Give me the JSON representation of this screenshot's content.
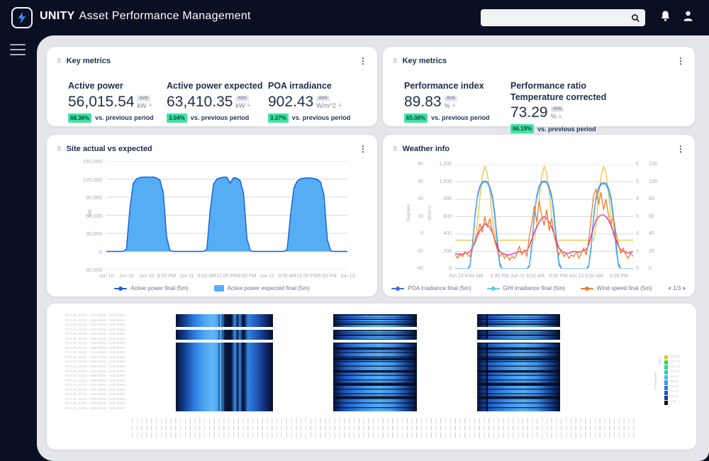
{
  "icons": {
    "kebab": "⋮",
    "drag": "⠿",
    "series_menu": "≡",
    "prev": "◀",
    "next": "▶"
  },
  "colors": {
    "header_bg": "#0b0f23",
    "content_bg": "#e5e6e9",
    "accent_blue": "#2f7ff0",
    "green_badge": "#3fe3a5",
    "site_fill": "#55aef4",
    "site_stroke": "#2a7de2",
    "site_actual": "#1a5fd9",
    "poa": "#3a6df0",
    "ghi": "#62c8f2",
    "wind": "#f07c2e",
    "yellow": "#f2c23e",
    "magenta": "#e8258e"
  },
  "header": {
    "brand_bold": "UNITY",
    "brand_rest": "Asset Performance Management",
    "search_placeholder": "",
    "search_value": ""
  },
  "cards": {
    "key_metrics_left": {
      "title": "Key metrics",
      "metrics": [
        {
          "label": "Active power",
          "value": "56,015.54",
          "avg_badge": "AVG",
          "unit": "kW",
          "change": "68.36%",
          "change_label": "vs. previous period"
        },
        {
          "label": "Active power expected",
          "value": "63,410.35",
          "avg_badge": "AVG",
          "unit": "kW",
          "change": "3.04%",
          "change_label": "vs. previous period"
        },
        {
          "label": "POA irradiance",
          "value": "902.43",
          "avg_badge": "AVG",
          "unit": "W/m^2",
          "change": "3.37%",
          "change_label": "vs. previous period"
        }
      ]
    },
    "key_metrics_right": {
      "title": "Key metrics",
      "metrics": [
        {
          "label": "Performance index",
          "value": "89.83",
          "avg_badge": "AVG",
          "unit": "%",
          "change": "65.08%",
          "change_label": "vs. previous period"
        },
        {
          "label": "Performance ratio\nTemperature corrected",
          "value": "73.29",
          "avg_badge": "AVG",
          "unit": "%",
          "change": "66.19%",
          "change_label": "vs. previous period"
        }
      ]
    },
    "site": {
      "title": "Site actual vs expected"
    },
    "weather": {
      "title": "Weather info",
      "pagination": "1/3"
    },
    "heatmap": {
      "legend_title_line1": "Performance",
      "legend_title_line2": "Index",
      "legend_ticks": [
        "200.00",
        "177.78",
        "155.56",
        "133.33",
        "111.11",
        "88.89",
        "66.67",
        "44.44",
        "22.22",
        "0.00"
      ],
      "colormap": [
        "#e9c91a",
        "#3ad45e",
        "#2cd98c",
        "#31cac2",
        "#56b5f3",
        "#3f97f0",
        "#2e78e6",
        "#2256ce",
        "#1a389a",
        "#0a0e2c"
      ],
      "row_labels": [
        "PCS-50_INV02 - 1725.00kW - 1250.00kW",
        "PCS-48_INV01 - 1856.00kW - 1250.00kW",
        "PCS-45_INV01 - 1856.00kW - 1250.00kW",
        "PCS-43_INV01 - 1800.00kW - 1250.00kW",
        "PCS-40_INV02 - 1725.00kW - 1250.00kW",
        "PCS-38_INV01 - 1856.00kW - 1250.00kW",
        "PCS-35_INV01 - 1856.00kW - 1250.00kW",
        "PCS-33_INV01 - 1800.00kW - 1250.00kW",
        "PCS-30_INV02 - 1725.00kW - 1250.00kW",
        "PCS-28_INV01 - 1856.00kW - 1250.00kW",
        "PCS-25_INV01 - 1856.00kW - 1250.00kW",
        "PCS-23_INV01 - 1800.00kW - 1250.00kW",
        "PCS-20_INV02 - 1725.00kW - 1250.00kW",
        "PCS-18_INV01 - 1856.00kW - 1250.00kW",
        "PCS-15_INV01 - 1856.00kW - 1250.00kW",
        "PCS-13_INV01 - 1800.00kW - 1250.00kW",
        "PCS-10_INV02 - 1725.00kW - 1250.00kW",
        "PCS-08_INV01 - 1856.00kW - 1250.00kW",
        "PCS-05_INV01 - 1856.00kW - 1250.00kW",
        "PCS-03_INV01 - 1800.00kW - 1250.00kW",
        "PCS-00_INV01 - 1800.00kW - 1250.00kW"
      ]
    }
  },
  "chart_data": [
    {
      "id": "site",
      "type": "area",
      "title": "Site actual vs expected",
      "ylabel": "kW",
      "ylim": [
        -30000,
        150000
      ],
      "yticks": [
        "150,000",
        "120,000",
        "90,000",
        "60,000",
        "30,000",
        "0",
        "-30,000"
      ],
      "xticks": [
        "Jun 10",
        "Jun 10",
        "Jun 10",
        "6:00 PM",
        "Jun 11",
        "6:00 AM",
        "12:00 PM",
        "6:00 PM",
        "Jun 12",
        "6:00 AM",
        "12:00 PM",
        "6:00 PM",
        "Jun 13"
      ],
      "x_start": "Jun 10 00:00",
      "x_step_hours": 1,
      "grid": true,
      "legend_position": "bottom",
      "series": [
        {
          "name": "Active power final (5m)",
          "style": "line",
          "color": "#1a5fd9",
          "marker": "dot",
          "values": [
            0,
            0,
            0,
            0,
            0,
            0,
            3800,
            69000,
            113000,
            120500,
            122800,
            123400,
            123300,
            123000,
            123500,
            121800,
            118000,
            97000,
            24000,
            1400,
            0,
            0,
            0,
            0,
            0,
            0,
            0,
            0,
            0,
            0,
            3300,
            67000,
            112000,
            120000,
            122300,
            123100,
            122900,
            114000,
            122000,
            121200,
            117000,
            95000,
            21000,
            1100,
            0,
            0,
            0,
            0,
            0,
            0,
            0,
            0,
            0,
            0,
            2800,
            59000,
            104000,
            116500,
            120800,
            121700,
            121800,
            121500,
            120700,
            119000,
            114500,
            93000,
            19000,
            900,
            0,
            0,
            0,
            0,
            0
          ]
        },
        {
          "name": "Active power expected final (5m)",
          "style": "area",
          "color": "#55aef4",
          "stroke": "#2a7de2",
          "values": [
            0,
            0,
            0,
            0,
            0,
            0,
            4000,
            70000,
            112000,
            120000,
            122500,
            123300,
            123500,
            123200,
            123400,
            122000,
            118500,
            98000,
            25000,
            1500,
            0,
            0,
            0,
            0,
            0,
            0,
            0,
            0,
            0,
            0,
            3500,
            68000,
            111000,
            119500,
            122000,
            123000,
            123200,
            112500,
            122500,
            121500,
            117500,
            96000,
            22000,
            1200,
            0,
            0,
            0,
            0,
            0,
            0,
            0,
            0,
            0,
            0,
            3000,
            60000,
            105000,
            117000,
            120500,
            121500,
            122000,
            121800,
            121000,
            119500,
            115000,
            94000,
            20000,
            1000,
            0,
            0,
            0,
            0,
            0
          ]
        }
      ]
    },
    {
      "id": "weather",
      "type": "line",
      "title": "Weather info",
      "grid": true,
      "legend_pagination": "1/3",
      "axes": {
        "left_outer": {
          "label": "Degrees",
          "range": [
            -40,
            80
          ],
          "ticks": [
            "80",
            "60",
            "40",
            "20",
            "0",
            "-20",
            "-40"
          ]
        },
        "left_inner": {
          "label": "W/m^2",
          "range": [
            0,
            1200
          ],
          "ticks": [
            "1,200",
            "1,000",
            "800",
            "600",
            "400",
            "200",
            "0"
          ]
        },
        "right_inner": {
          "range": [
            0,
            6
          ],
          "ticks": [
            "6",
            "5",
            "4",
            "3",
            "2",
            "1",
            "0"
          ]
        },
        "right_outer": {
          "range": [
            0,
            120
          ],
          "ticks": [
            "120",
            "100",
            "80",
            "60",
            "40",
            "20",
            "0"
          ]
        }
      },
      "xticks": [
        "Jun 10 6:00 AM",
        "6:00 PM Jun 11 6:00 AM",
        "6:00 PM Jun 12 6:00 AM",
        "6:00 PM"
      ],
      "xtick_fracs": [
        0.06,
        0.35,
        0.68,
        0.92
      ],
      "x_start": "Jun 10 00:00",
      "x_step_hours": 1,
      "series": [
        {
          "name": "unlabeled-yellow",
          "in_legend": false,
          "axis": "left_inner",
          "color": "#f2c23e",
          "values": [
            330,
            330,
            330,
            330,
            330,
            330,
            330,
            330,
            330,
            520,
            820,
            1060,
            1180,
            1100,
            880,
            600,
            380,
            330,
            330,
            330,
            330,
            330,
            330,
            330,
            330,
            330,
            330,
            330,
            330,
            330,
            330,
            330,
            330,
            520,
            820,
            1060,
            1180,
            1100,
            880,
            600,
            380,
            330,
            330,
            330,
            330,
            330,
            330,
            330,
            330,
            330,
            330,
            330,
            330,
            330,
            330,
            330,
            330,
            520,
            820,
            1060,
            1180,
            1100,
            880,
            600,
            380,
            330,
            330,
            330,
            330,
            330,
            330,
            330,
            330
          ]
        },
        {
          "name": "POA irradiance final (5m)",
          "in_legend": true,
          "axis": "left_inner",
          "color": "#3a6df0",
          "values": [
            0,
            0,
            0,
            0,
            0,
            0,
            40,
            280,
            620,
            840,
            950,
            1000,
            1010,
            1000,
            945,
            845,
            640,
            330,
            70,
            0,
            0,
            0,
            0,
            0,
            0,
            0,
            0,
            0,
            0,
            0,
            40,
            280,
            620,
            840,
            950,
            1000,
            1010,
            1000,
            945,
            845,
            640,
            330,
            70,
            0,
            0,
            0,
            0,
            0,
            0,
            0,
            0,
            0,
            0,
            0,
            35,
            260,
            600,
            820,
            930,
            980,
            990,
            982,
            930,
            825,
            615,
            310,
            60,
            0,
            0,
            0,
            0,
            0,
            0
          ]
        },
        {
          "name": "GHI irradiance final (5m)",
          "in_legend": true,
          "axis": "left_inner",
          "color": "#62c8f2",
          "values": [
            0,
            0,
            0,
            0,
            0,
            0,
            20,
            230,
            580,
            810,
            925,
            985,
            1000,
            988,
            920,
            800,
            580,
            260,
            35,
            0,
            0,
            0,
            0,
            0,
            0,
            0,
            0,
            0,
            0,
            0,
            20,
            230,
            580,
            810,
            925,
            985,
            1000,
            988,
            920,
            800,
            580,
            260,
            35,
            0,
            0,
            0,
            0,
            0,
            0,
            0,
            0,
            0,
            0,
            0,
            18,
            215,
            560,
            795,
            905,
            965,
            975,
            965,
            900,
            780,
            560,
            240,
            30,
            0,
            0,
            0,
            0,
            0,
            0
          ]
        },
        {
          "name": "unlabeled-magenta",
          "in_legend": false,
          "axis": "right_inner",
          "color": "#e8258e",
          "values": [
            0.9,
            0.85,
            0.8,
            0.85,
            0.9,
            0.9,
            1.0,
            1.2,
            1.5,
            1.9,
            2.2,
            2.4,
            2.6,
            2.5,
            2.4,
            2.1,
            1.7,
            1.3,
            1.0,
            0.9,
            0.85,
            0.8,
            0.8,
            0.85,
            0.9,
            0.95,
            1.0,
            0.95,
            1.0,
            1.05,
            1.3,
            1.7,
            2.1,
            2.4,
            2.7,
            2.9,
            3.0,
            2.9,
            2.7,
            2.4,
            2.0,
            1.6,
            1.2,
            1.0,
            0.95,
            0.9,
            0.9,
            0.95,
            1.0,
            1.0,
            0.95,
            1.0,
            1.05,
            1.1,
            1.4,
            1.9,
            2.4,
            2.8,
            3.0,
            3.1,
            3.1,
            3.0,
            2.8,
            2.5,
            2.1,
            1.7,
            1.3,
            1.1,
            1.0,
            0.95,
            0.9,
            0.95,
            1.0
          ]
        },
        {
          "name": "Wind speed final (5m)",
          "in_legend": true,
          "axis": "right_inner",
          "color": "#f07c2e",
          "values": [
            0.8,
            0.6,
            0.9,
            0.7,
            1.0,
            0.8,
            0.7,
            1.2,
            1.6,
            2.0,
            2.6,
            2.1,
            3.0,
            2.4,
            2.9,
            2.2,
            1.6,
            1.1,
            0.7,
            0.9,
            0.6,
            0.8,
            0.5,
            0.7,
            0.6,
            0.9,
            1.3,
            0.8,
            1.1,
            0.7,
            1.9,
            2.6,
            3.6,
            2.7,
            3.9,
            3.1,
            2.5,
            3.4,
            2.2,
            2.9,
            2.0,
            1.3,
            0.8,
            1.1,
            0.7,
            0.9,
            0.6,
            0.8,
            0.7,
            1.0,
            0.6,
            0.9,
            1.2,
            0.8,
            1.6,
            2.9,
            4.2,
            4.6,
            3.7,
            4.4,
            3.4,
            4.0,
            3.1,
            2.6,
            3.0,
            2.1,
            1.4,
            0.9,
            1.2,
            0.8,
            0.6,
            0.9,
            0.7
          ]
        }
      ]
    },
    {
      "id": "performance-heatmap",
      "type": "heatmap",
      "legend_title": "Performance Index",
      "legend_ticks": [
        200.0,
        177.78,
        155.56,
        133.33,
        111.11,
        88.89,
        66.67,
        44.44,
        22.22,
        0.0
      ],
      "colormap": [
        "#e9c91a",
        "#3ad45e",
        "#2cd98c",
        "#31cac2",
        "#56b5f3",
        "#3f97f0",
        "#2e78e6",
        "#2256ce",
        "#1a389a",
        "#0a0e2c"
      ],
      "panels": 3,
      "note": "per-cell values not legible in source"
    }
  ]
}
